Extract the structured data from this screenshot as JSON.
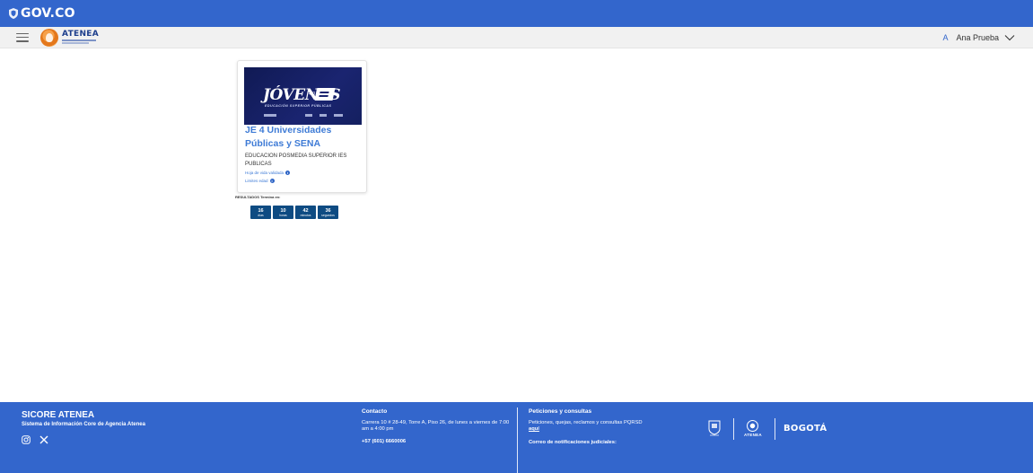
{
  "govbar": {
    "logo_text": "GOV.CO"
  },
  "header": {
    "brand_name": "ATENEA",
    "user_initial": "A",
    "user_name": "Ana Prueba"
  },
  "card": {
    "banner_title": "JÓVENES",
    "banner_number": "4.0",
    "banner_subtitle": "EDUCACIÓN SUPERIOR PÚBLICAS",
    "title": "JE 4 Universidades Públicas y SENA",
    "description": "EDUCACION POSMEDIA SUPERIOR IES PUBLICAS",
    "link_hoja": "Hoja de vida validada",
    "link_limites": "Limites edad"
  },
  "results": {
    "label": "RESULTADOS Termina en:",
    "countdown": [
      {
        "value": "16",
        "unit": "días"
      },
      {
        "value": "10",
        "unit": "horas"
      },
      {
        "value": "42",
        "unit": "minutos"
      },
      {
        "value": "36",
        "unit": "segundos"
      }
    ]
  },
  "footer": {
    "title": "SICORE ATENEA",
    "subtitle": "Sistema de Información Core de Agencia Atenea",
    "contact_heading": "Contacto",
    "contact_address": "Carrera 10 # 28-49, Torre A, Piso 26, de lunes a viernes de 7:00 am a 4:00 pm",
    "contact_phone": "+57 (601) 6660006",
    "peticiones_heading": "Peticiones y consultas",
    "peticiones_text": "Peticiones, quejas, reclamos y consultas PQRSD",
    "peticiones_link": "aquí",
    "notificaciones_text": "Correo de notificaciones judiciales:",
    "atenea_logo_text": "ATENEA",
    "bogota_logo_text": "BOGOTÁ"
  },
  "colors": {
    "gov_blue": "#3366cc",
    "title_blue": "#3e7bd6",
    "countdown_bg": "#0e4b82"
  },
  "icons": [
    "menu-icon",
    "chevron-down-icon",
    "info-icon",
    "instagram-icon",
    "x-icon",
    "gov-shield-icon"
  ]
}
